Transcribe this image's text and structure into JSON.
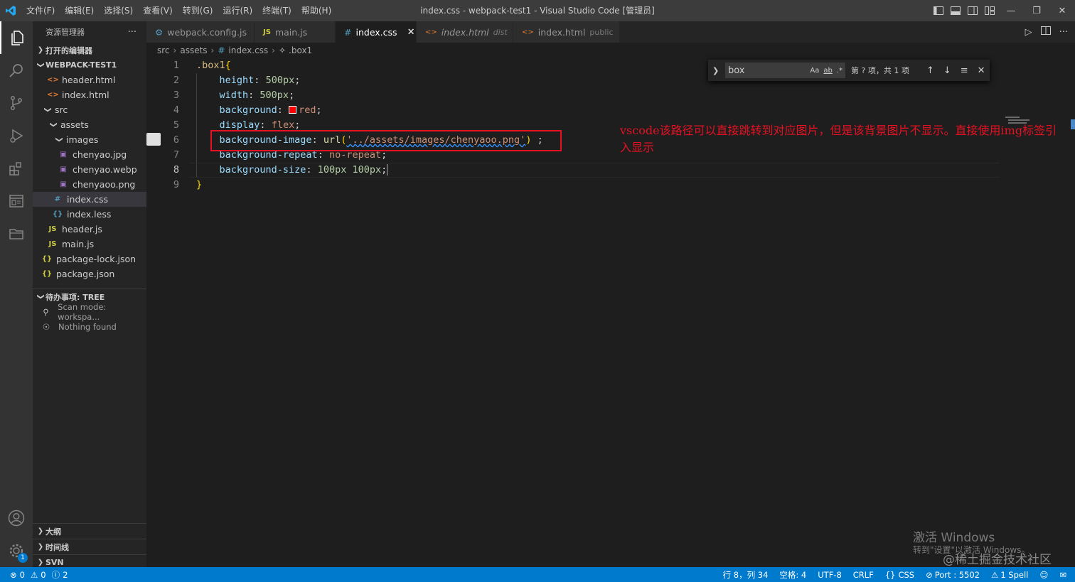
{
  "window": {
    "title": "index.css - webpack-test1 - Visual Studio Code [管理员]",
    "menu": [
      "文件(F)",
      "编辑(E)",
      "选择(S)",
      "查看(V)",
      "转到(G)",
      "运行(R)",
      "终端(T)",
      "帮助(H)"
    ]
  },
  "sidebar": {
    "title": "资源管理器",
    "open_editors": "打开的编辑器",
    "project": "WEBPACK-TEST1",
    "tree": [
      {
        "name": "header.html",
        "icon": "html"
      },
      {
        "name": "index.html",
        "icon": "html"
      },
      {
        "name": "src",
        "icon": "folder"
      },
      {
        "name": "assets",
        "icon": "folder"
      },
      {
        "name": "images",
        "icon": "folder"
      },
      {
        "name": "chenyao.jpg",
        "icon": "image"
      },
      {
        "name": "chenyao.webp",
        "icon": "image"
      },
      {
        "name": "chenyaoo.png",
        "icon": "image"
      },
      {
        "name": "index.css",
        "icon": "css"
      },
      {
        "name": "index.less",
        "icon": "less"
      },
      {
        "name": "header.js",
        "icon": "js"
      },
      {
        "name": "main.js",
        "icon": "js"
      },
      {
        "name": "package-lock.json",
        "icon": "json"
      },
      {
        "name": "package.json",
        "icon": "json"
      }
    ],
    "todo": {
      "title": "待办事项: TREE",
      "scan": "Scan mode: workspa...",
      "nothing": "Nothing found"
    },
    "outline": "大纲",
    "timeline": "时间线",
    "svn": "SVN",
    "account_badge": "1"
  },
  "tabs": [
    {
      "label": "webpack.config.js",
      "desc": "",
      "icon": "gear"
    },
    {
      "label": "main.js",
      "desc": "",
      "icon": "JS"
    },
    {
      "label": "index.css",
      "desc": "",
      "icon": "#"
    },
    {
      "label": "index.html",
      "desc": "dist",
      "icon": "<>"
    },
    {
      "label": "index.html",
      "desc": "public",
      "icon": "<>"
    }
  ],
  "breadcrumb": [
    "src",
    "assets",
    "index.css",
    ".box1"
  ],
  "editor": {
    "line_numbers": [
      "1",
      "2",
      "3",
      "4",
      "5",
      "6",
      "7",
      "8",
      "9"
    ],
    "l1_sel": ".box1",
    "l1_brace": "{",
    "l2_prop": "height",
    "l2_val": "500px",
    "l3_prop": "width",
    "l3_val": "500px",
    "l4_prop": "background",
    "l4_val": "red",
    "l5_prop": "display",
    "l5_val": "flex",
    "l6_prop": "background-image",
    "l6_fn": "url",
    "l6_str": "'../assets/images/chenyaoo.png'",
    "l7_prop": "background-repeat",
    "l7_val": "no-repeat",
    "l8_prop": "background-size",
    "l8_val": "100px 100px",
    "l9_brace": "}",
    "annotation": "vscode该路径可以直接跳转到对应图片，但是该背景图片不显示。直接使用img标签引入显示"
  },
  "find": {
    "value": "box",
    "opt_case": "Aa",
    "opt_word": "ab",
    "opt_regex": ".*",
    "count": "第 ? 项，共 1 项"
  },
  "watermark": {
    "activate": "激活 Windows",
    "activate_sub": "转到\"设置\"以激活 Windows。",
    "site": "@稀土掘金技术社区"
  },
  "status": {
    "errors": "0",
    "warnings": "0",
    "infos": "2",
    "position": "行 8，列 34",
    "spaces": "空格: 4",
    "encoding": "UTF-8",
    "eol": "CRLF",
    "language": "CSS",
    "port": "Port : 5502",
    "spell": "1 Spell"
  },
  "colors": {
    "accent": "#007acc",
    "annotation": "#e81123"
  }
}
